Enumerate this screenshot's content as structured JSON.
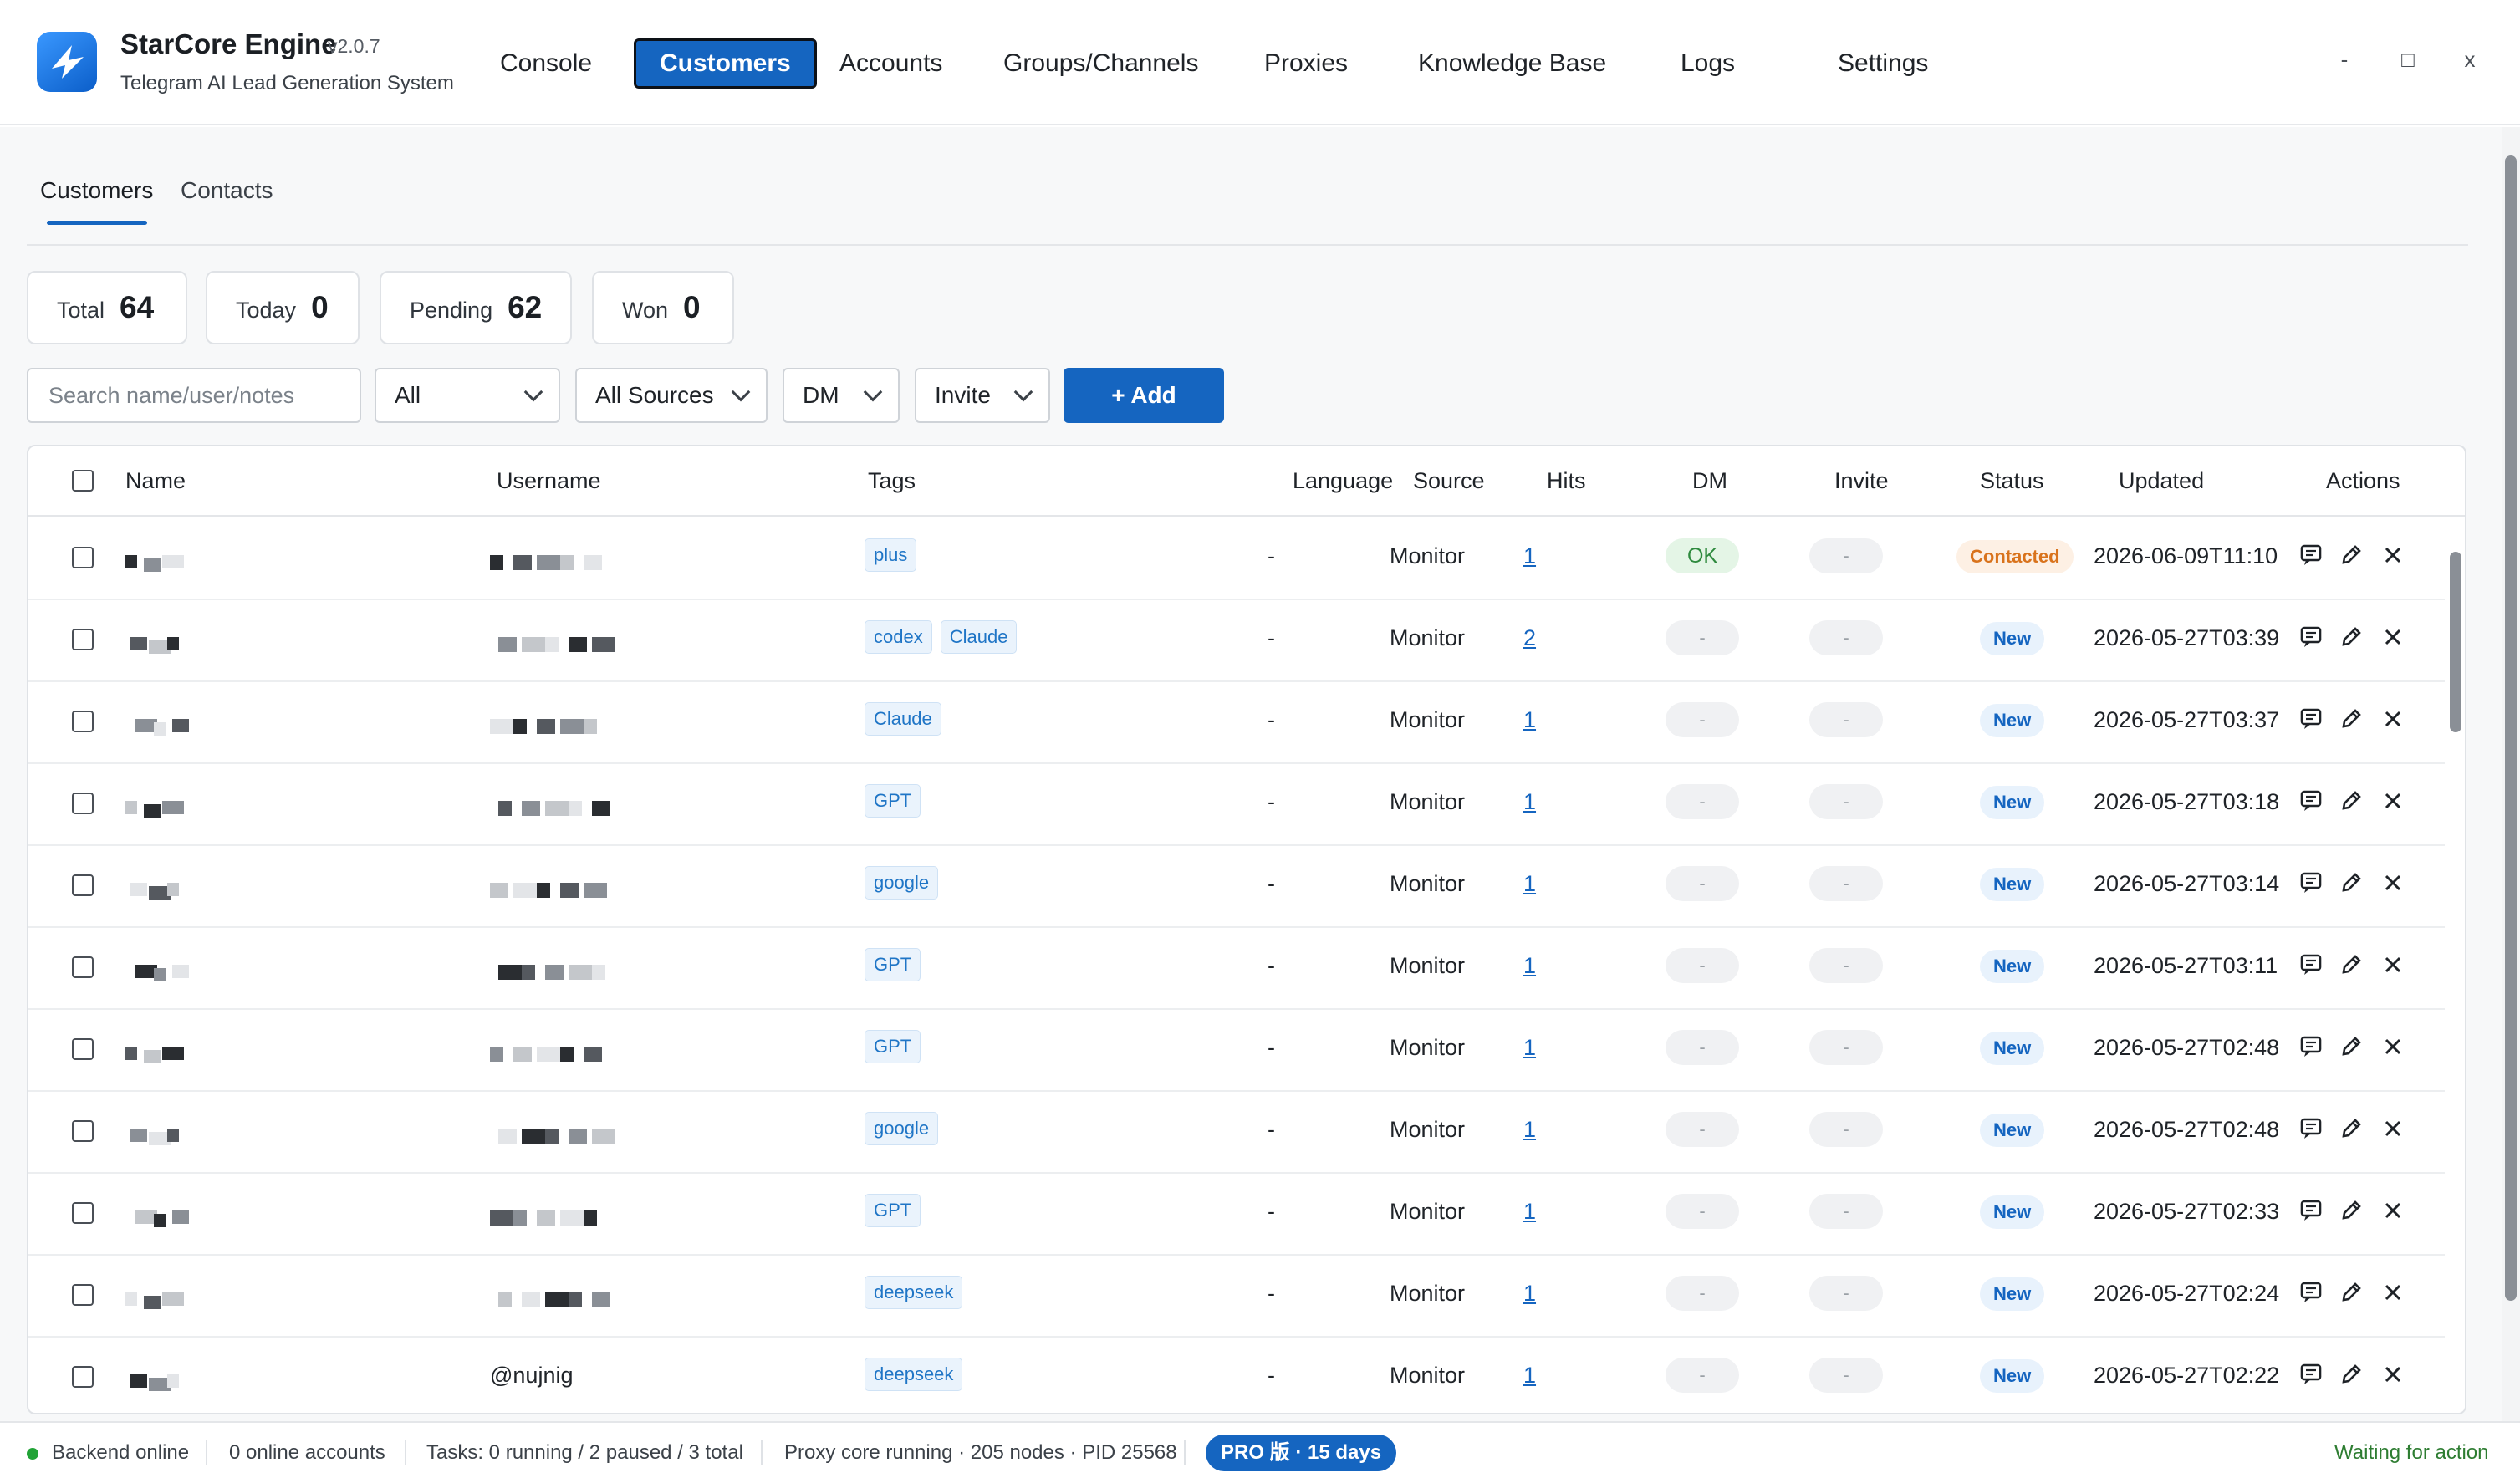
{
  "app": {
    "name": "StarCore Engine",
    "version": "v2.0.7",
    "subtitle": "Telegram AI Lead Generation System"
  },
  "nav": [
    "Console",
    "Customers",
    "Accounts",
    "Groups/Channels",
    "Proxies",
    "Knowledge Base",
    "Logs",
    "Settings"
  ],
  "nav_active": "Customers",
  "window": {
    "minimize": "-",
    "maximize": "□",
    "close": "x"
  },
  "subtabs": [
    "Customers",
    "Contacts"
  ],
  "stats": [
    {
      "label": "Total",
      "value": "64"
    },
    {
      "label": "Today",
      "value": "0"
    },
    {
      "label": "Pending",
      "value": "62"
    },
    {
      "label": "Won",
      "value": "0"
    }
  ],
  "filters": {
    "search_placeholder": "Search name/user/notes",
    "status_select": "All",
    "source_select": "All Sources",
    "dm_select": "DM",
    "invite_select": "Invite",
    "add_button": "+ Add"
  },
  "table": {
    "headers": [
      "Name",
      "Username",
      "Tags",
      "Language",
      "Source",
      "Hits",
      "DM",
      "Invite",
      "Status",
      "Updated",
      "Actions"
    ],
    "rows": [
      {
        "tags": [
          "plus"
        ],
        "language": "-",
        "source": "Monitor",
        "hits": "1",
        "dm": "OK",
        "invite": "-",
        "status": "Contacted",
        "updated": "2026-06-09T11:10",
        "username": ""
      },
      {
        "tags": [
          "codex",
          "Claude"
        ],
        "language": "-",
        "source": "Monitor",
        "hits": "2",
        "dm": "-",
        "invite": "-",
        "status": "New",
        "updated": "2026-05-27T03:39",
        "username": ""
      },
      {
        "tags": [
          "Claude"
        ],
        "language": "-",
        "source": "Monitor",
        "hits": "1",
        "dm": "-",
        "invite": "-",
        "status": "New",
        "updated": "2026-05-27T03:37",
        "username": ""
      },
      {
        "tags": [
          "GPT"
        ],
        "language": "-",
        "source": "Monitor",
        "hits": "1",
        "dm": "-",
        "invite": "-",
        "status": "New",
        "updated": "2026-05-27T03:18",
        "username": ""
      },
      {
        "tags": [
          "google"
        ],
        "language": "-",
        "source": "Monitor",
        "hits": "1",
        "dm": "-",
        "invite": "-",
        "status": "New",
        "updated": "2026-05-27T03:14",
        "username": ""
      },
      {
        "tags": [
          "GPT"
        ],
        "language": "-",
        "source": "Monitor",
        "hits": "1",
        "dm": "-",
        "invite": "-",
        "status": "New",
        "updated": "2026-05-27T03:11",
        "username": ""
      },
      {
        "tags": [
          "GPT"
        ],
        "language": "-",
        "source": "Monitor",
        "hits": "1",
        "dm": "-",
        "invite": "-",
        "status": "New",
        "updated": "2026-05-27T02:48",
        "username": ""
      },
      {
        "tags": [
          "google"
        ],
        "language": "-",
        "source": "Monitor",
        "hits": "1",
        "dm": "-",
        "invite": "-",
        "status": "New",
        "updated": "2026-05-27T02:48",
        "username": ""
      },
      {
        "tags": [
          "GPT"
        ],
        "language": "-",
        "source": "Monitor",
        "hits": "1",
        "dm": "-",
        "invite": "-",
        "status": "New",
        "updated": "2026-05-27T02:33",
        "username": ""
      },
      {
        "tags": [
          "deepseek"
        ],
        "language": "-",
        "source": "Monitor",
        "hits": "1",
        "dm": "-",
        "invite": "-",
        "status": "New",
        "updated": "2026-05-27T02:24",
        "username": ""
      },
      {
        "tags": [
          "deepseek"
        ],
        "language": "-",
        "source": "Monitor",
        "hits": "1",
        "dm": "-",
        "invite": "-",
        "status": "New",
        "updated": "2026-05-27T02:22",
        "username": "@nujnig"
      }
    ]
  },
  "statusbar": {
    "backend": "Backend online",
    "accounts": "0 online accounts",
    "tasks": "Tasks: 0 running / 2 paused / 3 total",
    "proxy": "Proxy core running · 205 nodes · PID 25568",
    "pro": "PRO 版 · 15 days",
    "right": "Waiting for action"
  },
  "colors": {
    "accent": "#1565c0",
    "online": "#21a336",
    "contacted": "#d9731c",
    "ok": "#2e8a3e",
    "waiting": "#2e7d32"
  },
  "icons": {
    "logo": "star-bird-logo",
    "row_actions": [
      "message-icon",
      "edit-icon",
      "delete-icon"
    ]
  }
}
